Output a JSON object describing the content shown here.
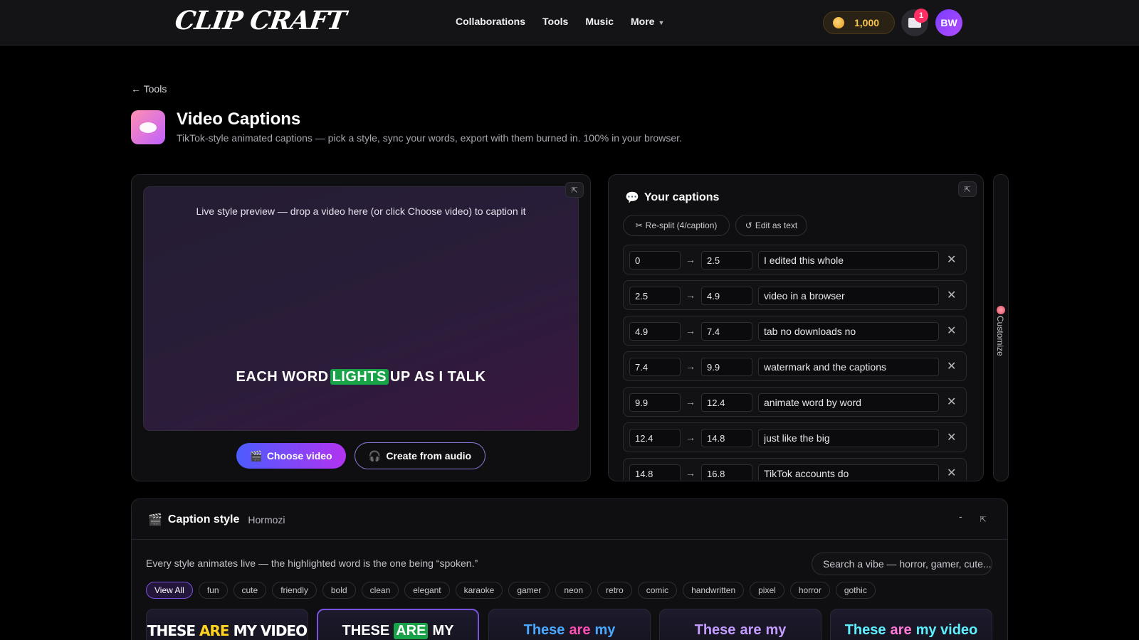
{
  "nav": {
    "logo": "CLIP CRAFT",
    "links": [
      "Collaborations",
      "Tools",
      "Music"
    ],
    "more": "More",
    "coins": "1,000",
    "notifications": "1",
    "avatar": "BW"
  },
  "header": {
    "back": "← Tools",
    "title": "Video Captions",
    "subtitle": "TikTok-style animated captions — pick a style, sync your words, export with them burned in. 100% in your browser."
  },
  "preview": {
    "hint": "Live style preview — drop a video here (or click Choose video) to caption it",
    "caption_before": "EACH WORD",
    "caption_highlight": "LIGHTS",
    "caption_after": "UP AS I TALK",
    "highlight_color": "#18a349",
    "choose_label": "Choose video",
    "audio_label": "Create from audio"
  },
  "captions": {
    "title": "Your captions",
    "resplit_label": "Re-split (4/caption)",
    "edit_text_label": "Edit as text",
    "rows": [
      {
        "start": "0",
        "end": "2.5",
        "text": "I edited this whole"
      },
      {
        "start": "2.5",
        "end": "4.9",
        "text": "video in a browser"
      },
      {
        "start": "4.9",
        "end": "7.4",
        "text": "tab no downloads no"
      },
      {
        "start": "7.4",
        "end": "9.9",
        "text": "watermark and the captions"
      },
      {
        "start": "9.9",
        "end": "12.4",
        "text": "animate word by word"
      },
      {
        "start": "12.4",
        "end": "14.8",
        "text": "just like the big"
      },
      {
        "start": "14.8",
        "end": "16.8",
        "text": "TikTok accounts do"
      }
    ],
    "customize_label": "Customize"
  },
  "style": {
    "title": "Caption style",
    "selected": "Hormozi",
    "collapse": "-",
    "description": "Every style animates live — the highlighted word is the one being “spoken.”",
    "search_placeholder": "Search a vibe — horror, gamer, cute...",
    "filters": [
      "View All",
      "fun",
      "cute",
      "friendly",
      "bold",
      "clean",
      "elegant",
      "karaoke",
      "gamer",
      "neon",
      "retro",
      "comic",
      "handwritten",
      "pixel",
      "horror",
      "gothic"
    ],
    "cards": [
      {
        "w1": "THESE",
        "w2": "ARE",
        "w3": "MY VIDEO"
      },
      {
        "w1": "THESE",
        "w2": "ARE",
        "w3": "MY"
      },
      {
        "w1": "These",
        "w2": "are",
        "w3": "my"
      },
      {
        "w1": "These",
        "w2": "are",
        "w3": "my"
      },
      {
        "w1": "These",
        "w2": "are",
        "w3": "my video"
      }
    ]
  },
  "colors": {
    "accent": "#7a52e0",
    "coin": "#f5c24b",
    "badge": "#ff2e63"
  }
}
